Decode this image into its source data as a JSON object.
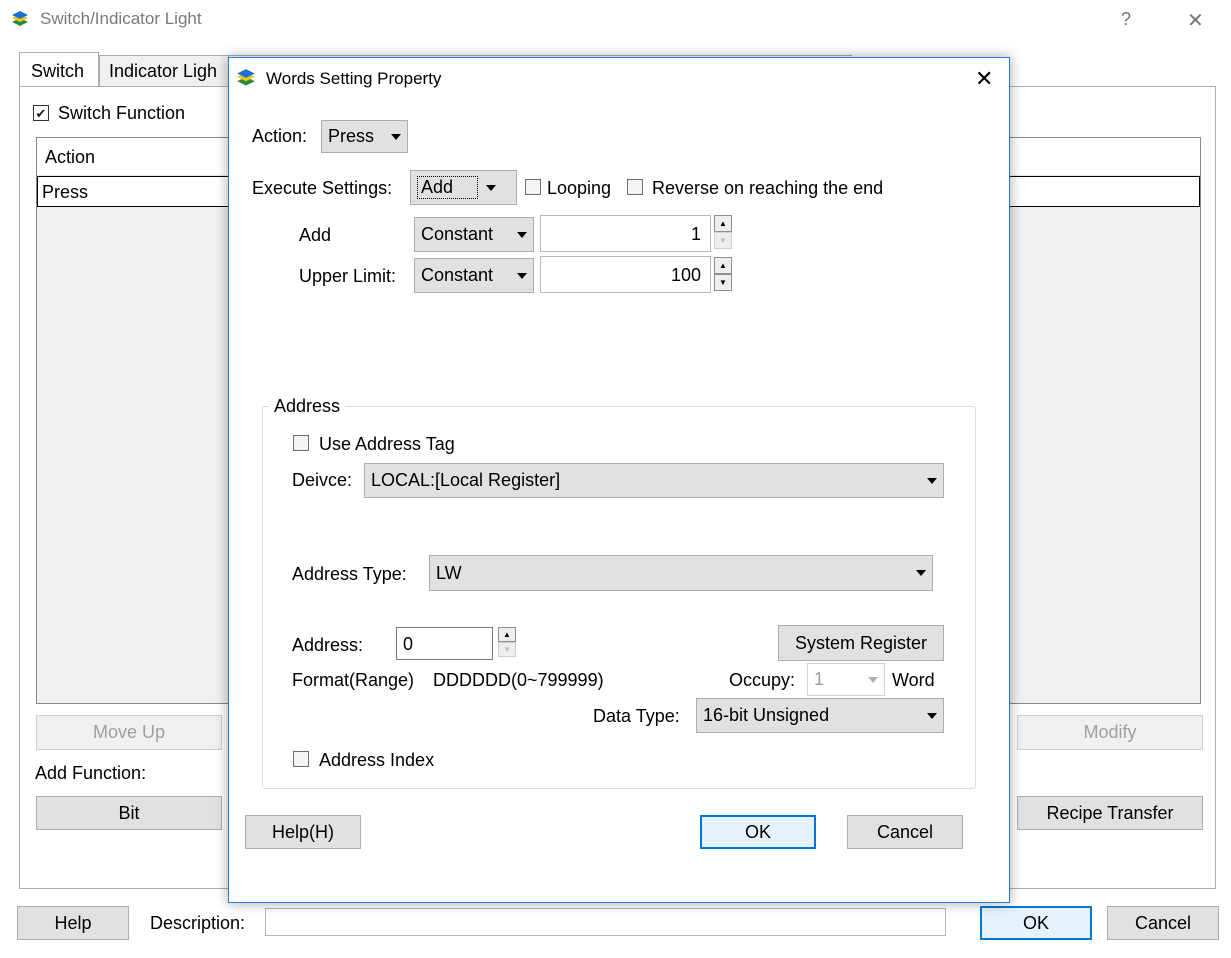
{
  "main_window": {
    "title": "Switch/Indicator Light",
    "help_glyph": "?",
    "close_glyph": "✕",
    "tabs": [
      "Switch",
      "Indicator Ligh"
    ],
    "switch_function_label": "Switch Function",
    "switch_function_checked": true,
    "table": {
      "header": "Action",
      "rows": [
        "Press"
      ]
    },
    "move_up_label": "Move Up",
    "modify_label": "Modify",
    "add_function_label": "Add Function:",
    "bit_label": "Bit",
    "recipe_transfer_label": "Recipe Transfer",
    "help_label": "Help",
    "description_label": "Description:",
    "description_value": "",
    "ok_label": "OK",
    "cancel_label": "Cancel"
  },
  "dialog": {
    "title": "Words Setting Property",
    "close_glyph": "✕",
    "action_label": "Action:",
    "action_value": "Press",
    "execute_label": "Execute Settings:",
    "execute_value": "Add",
    "looping_label": "Looping",
    "looping_checked": false,
    "reverse_label": "Reverse on reaching the end",
    "reverse_checked": false,
    "add_label": "Add",
    "add_type": "Constant",
    "add_value": "1",
    "upper_limit_label": "Upper Limit:",
    "upper_type": "Constant",
    "upper_value": "100",
    "address_group": {
      "title": "Address",
      "use_tag_label": "Use Address Tag",
      "use_tag_checked": false,
      "device_label": "Deivce:",
      "device_value": "LOCAL:[Local Register]",
      "address_type_label": "Address Type:",
      "address_type_value": "LW",
      "address_label": "Address:",
      "address_value": "0",
      "system_register_label": "System Register",
      "format_label": "Format(Range)",
      "format_value": "DDDDDD(0~799999)",
      "occupy_label": "Occupy:",
      "occupy_value": "1",
      "word_label": "Word",
      "data_type_label": "Data Type:",
      "data_type_value": "16-bit Unsigned",
      "address_index_label": "Address Index",
      "address_index_checked": false
    },
    "help_label": "Help(H)",
    "ok_label": "OK",
    "cancel_label": "Cancel"
  },
  "colors": {
    "accent": "#0078d7",
    "dialog_border": "#1e7fd0",
    "button_face": "#e1e1e1"
  }
}
